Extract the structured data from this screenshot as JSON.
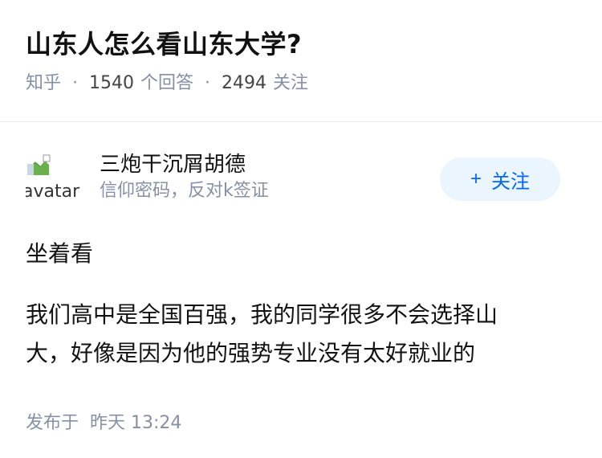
{
  "question": {
    "title": "山东人怎么看山东大学?",
    "source": "知乎",
    "answers_count": "1540",
    "answers_label": "个回答",
    "followers_count": "2494",
    "followers_label": "关注"
  },
  "author": {
    "name": "三炮干沉屑胡德",
    "bio": "信仰密码，反对k签证",
    "avatar_alt": "avatar",
    "follow_label": "关注",
    "follow_icon": "+"
  },
  "answer": {
    "paragraphs": [
      "坐着看",
      "我们高中是全国百强，我的同学很多不会选择山大，好像是因为他的强势专业没有太好就业的"
    ],
    "published_label": "发布于",
    "published_time": "昨天 13:24"
  },
  "colors": {
    "accent": "#0066ff",
    "follow_bg": "#ebf5fd",
    "meta_gray": "#8590a6"
  }
}
